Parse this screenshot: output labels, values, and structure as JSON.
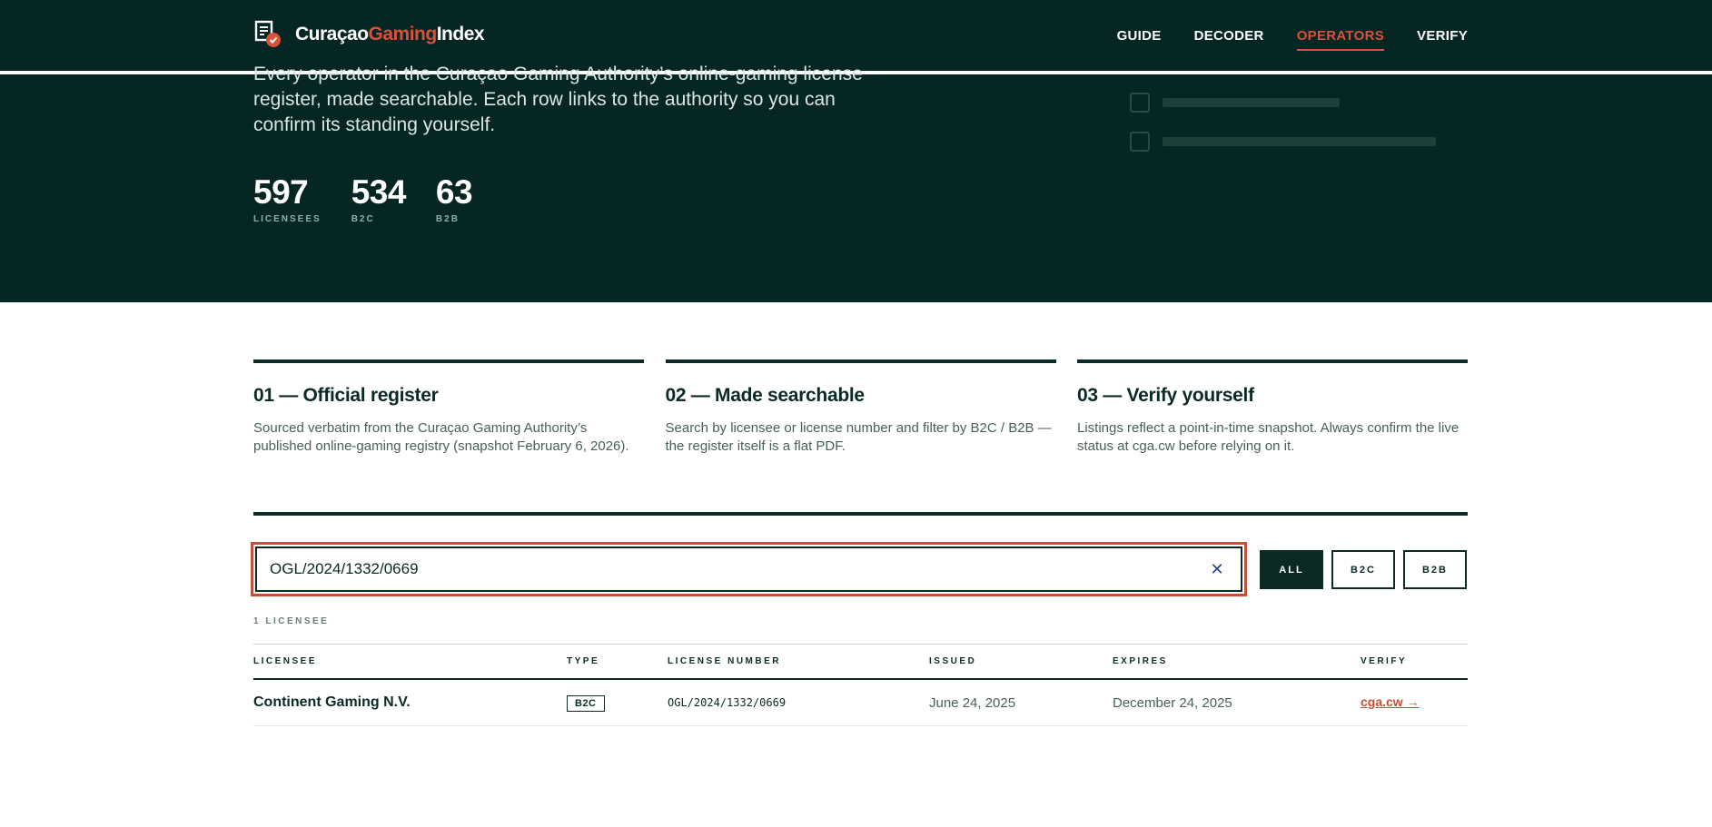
{
  "brand": {
    "part1": "Curaçao",
    "part2": "Gaming",
    "part3": "Index"
  },
  "nav": [
    {
      "label": "GUIDE",
      "active": false
    },
    {
      "label": "DECODER",
      "active": false
    },
    {
      "label": "OPERATORS",
      "active": true
    },
    {
      "label": "VERIFY",
      "active": false
    }
  ],
  "hero": {
    "description": "Every operator in the Curaçao Gaming Authority’s online-gaming license register, made searchable. Each row links to the authority so you can confirm its standing yourself.",
    "stats": [
      {
        "value": "597",
        "label": "LICENSEES"
      },
      {
        "value": "534",
        "label": "B2C"
      },
      {
        "value": "63",
        "label": "B2B"
      }
    ]
  },
  "features": [
    {
      "title": "01 — Official register",
      "text": "Sourced verbatim from the Curaçao Gaming Authority’s published online-gaming registry (snapshot February 6, 2026)."
    },
    {
      "title": "02 — Made searchable",
      "text": "Search by licensee or license number and filter by B2C / B2B — the register itself is a flat PDF."
    },
    {
      "title": "03 — Verify yourself",
      "text": "Listings reflect a point-in-time snapshot. Always confirm the live status at cga.cw before relying on it."
    }
  ],
  "search": {
    "value": "OGL/2024/1332/0669",
    "clear_icon": "close-icon"
  },
  "filters": [
    {
      "label": "ALL",
      "active": true
    },
    {
      "label": "B2C",
      "active": false
    },
    {
      "label": "B2B",
      "active": false
    }
  ],
  "result_count": "1 LICENSEE",
  "table": {
    "headers": [
      "LICENSEE",
      "TYPE",
      "LICENSE NUMBER",
      "ISSUED",
      "EXPIRES",
      "VERIFY"
    ],
    "rows": [
      {
        "licensee": "Continent Gaming N.V.",
        "type": "B2C",
        "license_number": "OGL/2024/1332/0669",
        "issued": "June 24, 2025",
        "expires": "December 24, 2025",
        "verify": "cga.cw →"
      }
    ]
  },
  "colors": {
    "dark": "#052622",
    "accent": "#d9513a"
  }
}
